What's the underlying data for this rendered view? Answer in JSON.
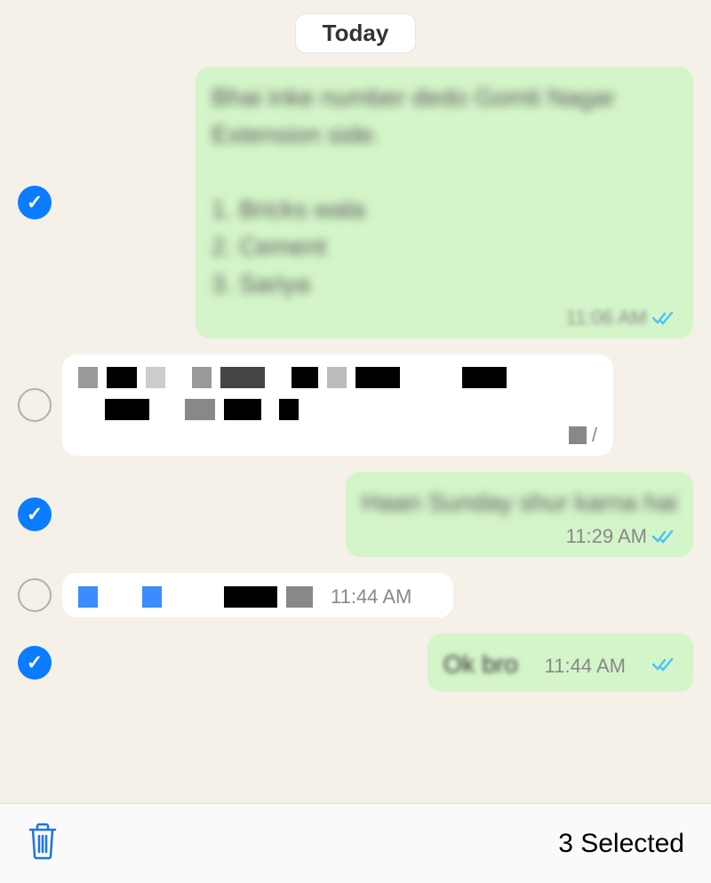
{
  "date_label": "Today",
  "messages": [
    {
      "direction": "outgoing",
      "selected": true,
      "text": "Bhai inke number dedo Gomti Nagar Extension side.\n\n1. Bricks wala\n2. Cement\n3. Sariya",
      "time": "11:06 AM",
      "read": true,
      "blurred": true
    },
    {
      "direction": "incoming",
      "selected": false,
      "redacted": true,
      "time": ""
    },
    {
      "direction": "outgoing",
      "selected": true,
      "text": "Haan Sunday shur karna hai",
      "time": "11:29 AM",
      "read": true,
      "blurred": true
    },
    {
      "direction": "incoming",
      "selected": false,
      "redacted": true,
      "time": "11:44 AM"
    },
    {
      "direction": "outgoing",
      "selected": true,
      "text": "Ok bro",
      "time": "11:44 AM",
      "read": true
    }
  ],
  "bottom_bar": {
    "selected_count": "3 Selected"
  }
}
